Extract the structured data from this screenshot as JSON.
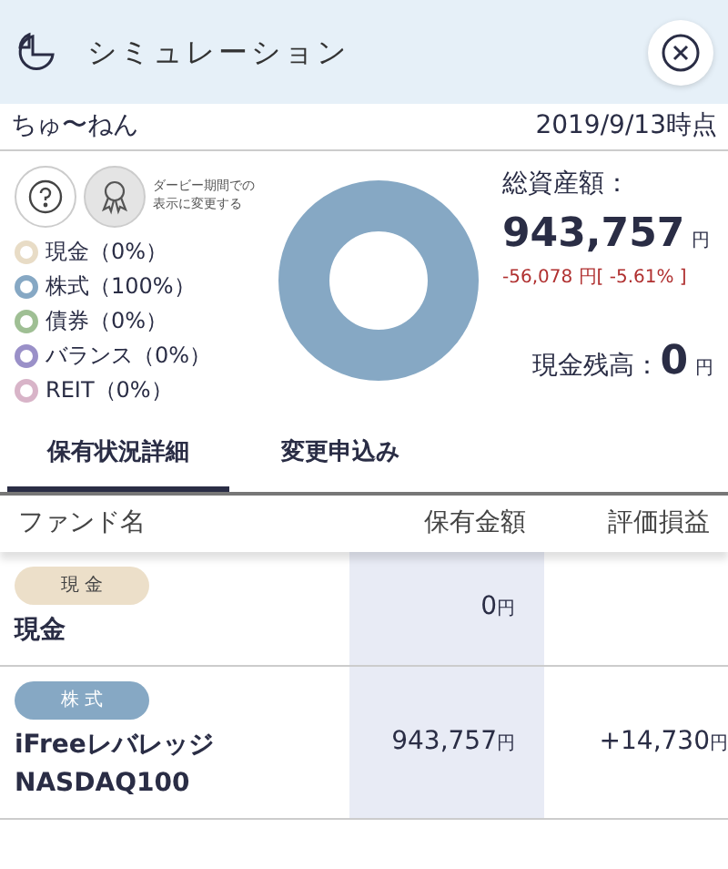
{
  "header": {
    "title": "シミュレーション"
  },
  "user": {
    "name": "ちゅ〜ねん",
    "as_of": "2019/9/13時点"
  },
  "derby_hint": "ダービー期間での表示に変更する",
  "legend": [
    {
      "label": "現金（0%）",
      "color": "#e8dcc6",
      "level": 0
    },
    {
      "label": "株式（100%）",
      "color": "#86a8c4",
      "level": 1
    },
    {
      "label": "債券（0%）",
      "color": "#9fbf94",
      "level": 0
    },
    {
      "label": "バランス（0%）",
      "color": "#9a90c8",
      "level": 0
    },
    {
      "label": "REIT（0%）",
      "color": "#d8b4c8",
      "level": 0
    }
  ],
  "total": {
    "label": "総資産額：",
    "amount": "943,757",
    "unit": "円",
    "change": "-56,078 円[ -5.61% ]"
  },
  "cash": {
    "label": "現金残高：",
    "amount": "0",
    "unit": "円"
  },
  "tabs": [
    {
      "label": "保有状況詳細",
      "selected": true
    },
    {
      "label": "変更申込み",
      "selected": false
    }
  ],
  "table": {
    "columns": [
      "ファンド名",
      "保有金額",
      "評価損益"
    ],
    "rows": [
      {
        "tag": "現 金",
        "color": "#ecdfc9",
        "name": "現金",
        "amount": "0",
        "unit": "円"
      },
      {
        "tag": "株 式",
        "color": "#86a8c4",
        "name": "iFreeレバレッジ\nNASDAQ100",
        "amount": "943,757",
        "unit": "円",
        "gain": "+14,730",
        "gain_unit": "円"
      }
    ]
  }
}
